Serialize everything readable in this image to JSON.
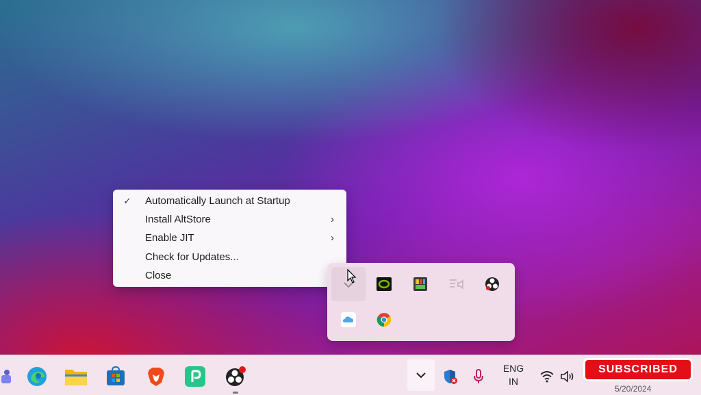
{
  "context_menu": {
    "items": [
      {
        "label": "Automatically Launch at Startup",
        "checked": true,
        "submenu": false
      },
      {
        "label": "Install AltStore",
        "checked": false,
        "submenu": true
      },
      {
        "label": "Enable JIT",
        "checked": false,
        "submenu": true
      },
      {
        "label": "Check for Updates...",
        "checked": false,
        "submenu": false
      },
      {
        "label": "Close",
        "checked": false,
        "submenu": false
      }
    ],
    "check_glyph": "✓",
    "chevron_glyph": "›"
  },
  "tray_overflow": {
    "icons": [
      "altserver-icon",
      "nvidia-icon",
      "color-app-icon",
      "audio-control-icon",
      "obs-icon",
      "icloud-icon",
      "chrome-icon"
    ]
  },
  "taskbar": {
    "apps": [
      "teams-icon",
      "edge-icon",
      "file-explorer-icon",
      "microsoft-store-icon",
      "brave-icon",
      "pickpoint-icon",
      "obs-icon"
    ],
    "language": {
      "line1": "ENG",
      "line2": "IN"
    },
    "clock_fragment": "5/20/2024",
    "subscribed_label": "SUBSCRIBED"
  },
  "colors": {
    "menu_bg": "#f9f7f9",
    "tray_bg": "#f1dde9",
    "taskbar_bg": "#f3e4ee",
    "subscribe_red": "#e40f16"
  }
}
